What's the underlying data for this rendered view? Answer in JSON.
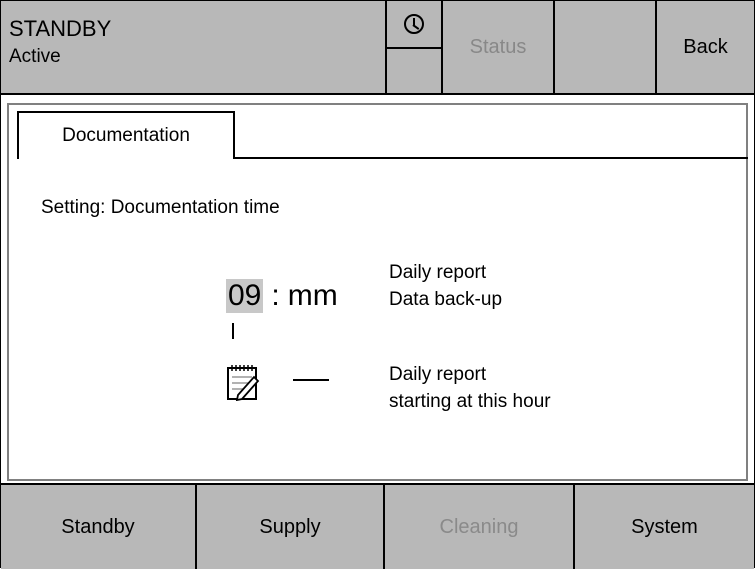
{
  "header": {
    "mode": "STANDBY",
    "state": "Active",
    "status_label": "Status",
    "back_label": "Back",
    "clock_icon": "clock-icon"
  },
  "tab": {
    "label": "Documentation"
  },
  "content": {
    "setting_label": "Setting: Documentation time",
    "hour_value": "09",
    "separator": ":",
    "minute_value": "mm",
    "desc1_line1": "Daily report",
    "desc1_line2": "Data back-up",
    "desc2_line1": "Daily report",
    "desc2_line2": "starting at this hour",
    "note_icon": "notepad-pencil-icon"
  },
  "footer": {
    "buttons": [
      {
        "label": "Standby",
        "enabled": true
      },
      {
        "label": "Supply",
        "enabled": true
      },
      {
        "label": "Cleaning",
        "enabled": false
      },
      {
        "label": "System",
        "enabled": true
      }
    ]
  },
  "colors": {
    "panel_gray": "#b8b8b8",
    "disabled_text": "#888888",
    "highlight_gray": "#c8c8c8"
  }
}
